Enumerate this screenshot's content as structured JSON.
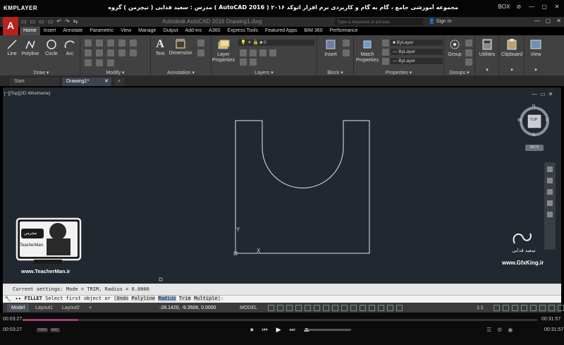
{
  "player": {
    "logo": "KMPLAYER",
    "title": "مجموعه آموزشی جامع ، گام به گام و کاربردی نرم افزار  اتوکد ۲۰۱۶ ( AutoCAD  2016 )  مدرس : سعید فدایی ( تیچرمن ) گروه آموزشی پادشاه گرافیست ها",
    "controls": [
      "BOX",
      "⊘",
      "—",
      "▢",
      "✕"
    ],
    "time_current": "00:03:27",
    "time_total": "00:31:57",
    "progress": 0.108,
    "codecs": [
      "H264",
      "AAC"
    ],
    "transport": [
      "⏹",
      "⏮",
      "▶",
      "⏭",
      "⏏"
    ]
  },
  "autocad": {
    "title_text": "Autodesk AutoCAD 2016    Drawing1.dwg",
    "search_placeholder": "Type a keyword or phrase",
    "signin": "Sign In",
    "qat": [
      "▭",
      "▭",
      "▭",
      "▭",
      "↶",
      "↷",
      "⇆"
    ],
    "window_buttons": [
      "—",
      "▢",
      "✕"
    ],
    "tabs": [
      "Home",
      "Insert",
      "Annotate",
      "Parametric",
      "View",
      "Manage",
      "Output",
      "Add-ins",
      "A360",
      "Express Tools",
      "Featured Apps",
      "BIM 360",
      "Performance"
    ],
    "active_tab": "Home",
    "panels": {
      "draw": {
        "label": "Draw ▾",
        "tools": [
          "Line",
          "Polyline",
          "Circle",
          "Arc"
        ]
      },
      "modify": {
        "label": "Modify ▾"
      },
      "annotation": {
        "label": "Annotation ▾",
        "tools": [
          "Text",
          "Dimension"
        ]
      },
      "layers": {
        "label": "Layers ▾",
        "tool": "Layer Properties",
        "layer_value": "0"
      },
      "block": {
        "label": "Block ▾",
        "tool": "Insert"
      },
      "properties": {
        "label": "Properties ▾",
        "tool": "Match Properties",
        "values": [
          "ByLayer",
          "ByLayer",
          "ByLayer"
        ]
      },
      "groups": {
        "label": "Groups ▾",
        "tool": "Group"
      },
      "utilities": {
        "tool": "Utilities"
      },
      "clipboard": {
        "tool": "Clipboard"
      },
      "view": {
        "tool": "View"
      }
    },
    "doc_tabs": {
      "start": "Start",
      "drawing": "Drawing1*",
      "add": "+"
    },
    "viewport_label": "[−][Top][2D Wireframe]",
    "viewport_controls": [
      "—",
      "▭",
      "✕"
    ],
    "viewcube": {
      "north": "N",
      "south": "S",
      "east": "E",
      "west": "W",
      "face": "TOP",
      "wcs": "WCS"
    },
    "command": {
      "history": "Current settings: Mode = TRIM, Radius = 6.0000",
      "prompt_name": "FILLET",
      "prompt_text": "Select first object or [",
      "options": [
        "Undo",
        "Polyline",
        "Radius",
        "Trim",
        "Multiple"
      ],
      "prompt_end": "]:"
    },
    "layout_tabs": [
      "Model",
      "Layout1",
      "Layout2",
      "+"
    ],
    "coordinates": "-28.1420, -9.3506, 0.0000",
    "status_right": [
      "MODEL",
      "1:1"
    ]
  },
  "watermark": {
    "teacherman_url": "www.TeacherMan.ir",
    "gfxking_url": "www.GfxKing.ir",
    "gfxking_name": "سعید فدایی",
    "badge_name": "TeacherMan",
    "badge_logo": "تیچرمن"
  }
}
